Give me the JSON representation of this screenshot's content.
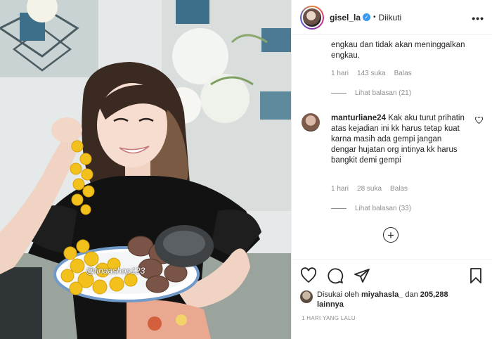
{
  "post": {
    "image_watermark": "@tinaashop123"
  },
  "header": {
    "username": "gisel_la",
    "separator": "•",
    "follow_status": "Diikuti",
    "more": "•••"
  },
  "comments": [
    {
      "text": "engkau dan tidak akan meninggalkan engkau.",
      "time": "1 hari",
      "likes": "143 suka",
      "reply": "Balas",
      "view_replies": "Lihat balasan (21)"
    },
    {
      "username": "manturliane24",
      "text": "Kak aku turut prihatin atas kejadian ini kk harus tetap kuat karna masih ada gempi jangan dengar hujatan org intinya kk harus bangkit demi gempi",
      "time": "1 hari",
      "likes": "28 suka",
      "reply": "Balas",
      "view_replies": "Lihat balasan (33)"
    }
  ],
  "load_more": "+",
  "likes": {
    "prefix": "Disukai oleh",
    "user": "miyahasla_",
    "conj": "dan",
    "others": "205,288 lainnya"
  },
  "timestamp": "1 HARI YANG LALU",
  "icons": [
    "heart-icon",
    "comment-icon",
    "share-icon",
    "bookmark-icon",
    "verified-icon",
    "more-icon",
    "add-circle-icon"
  ],
  "colors": {
    "verified": "#3897f0",
    "secondary_text": "#8e8e8e",
    "divider": "#efefef"
  }
}
